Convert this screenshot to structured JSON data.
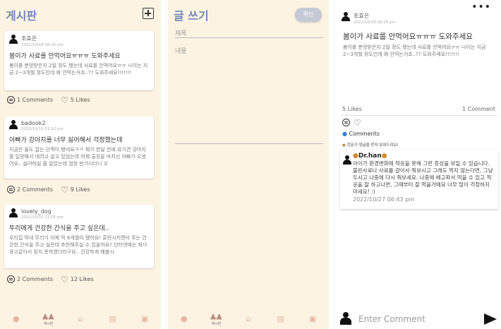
{
  "feed": {
    "title": "게시판",
    "posts": [
      {
        "author": "조효은",
        "date": "2022/10/18 09:26 pm",
        "title": "봄이가 사료를 안먹어요ㅠㅠㅠ 도와주세요",
        "body": "봄이를 분양받은지 2일 정도 됐는데 사료를 안먹어요ㅠㅠ 나이는 지금 2~3개월 정도인데 왜 안먹는거죠..?? 도와주세요!!!!!!!",
        "comments": "1 Comments",
        "likes": "5 Likes"
      },
      {
        "author": "badook2",
        "date": "2022/10/15 11:12 pm",
        "title": "아빠가 강아지를 너무 싫어해서 걱정했는데",
        "body": "지금은 둘도 없는 단짝이 됐네요ㅋㅋ 제가 한달 전에 유기견 강아지를 입양해서 데려고 살고 있었는데 어제 출장을 마치신 아빠가 오셨어요.. 싫어하실 줄 알았는데 엄청 반기시더니 오",
        "comments": "2 Comments",
        "likes": "9 Likes"
      },
      {
        "author": "lovely_dog",
        "date": "2022/10/15 11:05 pm",
        "title": "뚜리에게 건강한 간식을 주고 싶은데..",
        "body": "우리집 막내 뚜리가 이제 막 6개월이 됐어요! 훈련시키면서 주는 건강한 간식을 주고 싶은데 추천해주실 수 있을까요? 인터넷에는 죄다 광고같아서 믿지 못하겠더라구요.. 건강하게 해봅시",
        "comments": "2 Comments",
        "likes": "12 Likes"
      }
    ]
  },
  "nav": {
    "active_label": "게시판"
  },
  "write": {
    "title": "글 쓰기",
    "confirm": "확인",
    "title_placeholder": "제목",
    "content_placeholder": "내용"
  },
  "detail": {
    "menu": "•••",
    "author": "조효은",
    "date": "2022/10/18 09:26 pm",
    "title": "봄이가 사료를 안먹어요ㅠㅠㅠ 도와주세요",
    "body": "봄이를 분양받은지 2일 정도 됐는데 사료를 안먹어요ㅠㅠ 나이는 지금 2~3개월 정도인데 왜 안먹는거죠..?? 도와주세요!!!!!!!",
    "likes": "5 Likes",
    "comments_count": "1 Comment",
    "comments_label": "Comments",
    "notice": "전문가 댓글을 먼저 보여드려요!",
    "comment": {
      "author": "Dr.han",
      "text": "아이가 환경변화에 적응을 못해 그런 증상을 보일 수 있습니다. 불린사료나 사료를 갈아서 줘보시고 그래도 먹지 않는다면, 그냥 두시고 나중에 다시 줘보세요. 나중에 배고파서 먹을 수 있고 적응을 잘 하고나면, 그때부터 잘 먹을거에요 너무 많이 걱정하지 마세요! :)",
      "date": "2022/10/27 06:43 pm"
    },
    "input_placeholder": "Enter Comment"
  }
}
